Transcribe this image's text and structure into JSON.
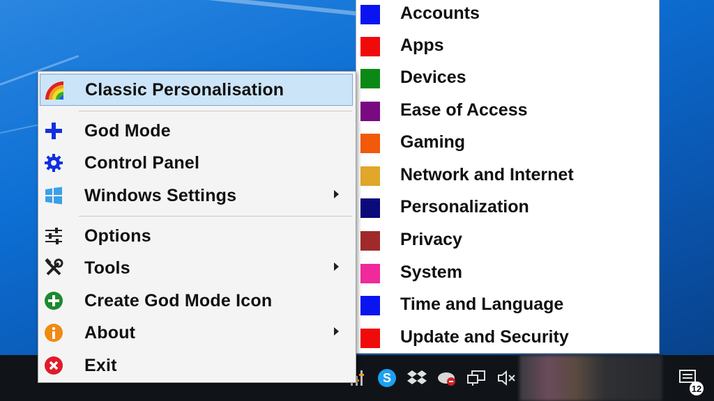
{
  "main_menu": {
    "items": [
      {
        "label": "Classic Personalisation",
        "icon": "rainbow-icon",
        "highlighted": true,
        "submenu": false
      },
      {
        "label": "God Mode",
        "icon": "plus-icon",
        "submenu": false
      },
      {
        "label": "Control Panel",
        "icon": "gear-icon",
        "submenu": false
      },
      {
        "label": "Windows Settings",
        "icon": "windows-logo-icon",
        "submenu": true
      },
      {
        "label": "Options",
        "icon": "sliders-icon",
        "submenu": false
      },
      {
        "label": "Tools",
        "icon": "tools-icon",
        "submenu": true
      },
      {
        "label": "Create God Mode Icon",
        "icon": "add-circle-icon",
        "submenu": false
      },
      {
        "label": "About",
        "icon": "info-icon",
        "submenu": true
      },
      {
        "label": "Exit",
        "icon": "close-circle-icon",
        "submenu": false
      }
    ]
  },
  "settings_submenu": {
    "items": [
      {
        "label": "Accounts",
        "color": "#0a14f0"
      },
      {
        "label": "Apps",
        "color": "#f00a0a"
      },
      {
        "label": "Devices",
        "color": "#0a8a14"
      },
      {
        "label": "Ease of Access",
        "color": "#7a0a82"
      },
      {
        "label": "Gaming",
        "color": "#f25a0a"
      },
      {
        "label": "Network and Internet",
        "color": "#e0a72a"
      },
      {
        "label": "Personalization",
        "color": "#0a0a7a"
      },
      {
        "label": "Privacy",
        "color": "#a02a2a"
      },
      {
        "label": "System",
        "color": "#f02a9a"
      },
      {
        "label": "Time and Language",
        "color": "#0a14f0"
      },
      {
        "label": "Update and Security",
        "color": "#f00a0a"
      }
    ]
  },
  "taskbar": {
    "tray_icons": [
      "chevron-up-icon",
      "equalizer-icon",
      "skype-icon",
      "dropbox-icon",
      "cloud-sync-icon",
      "network-icon",
      "volume-muted-icon"
    ],
    "notification_count": "12"
  }
}
